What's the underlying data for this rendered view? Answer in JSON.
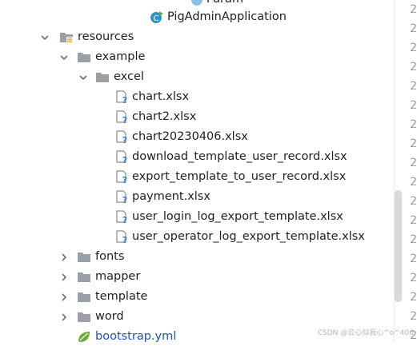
{
  "tree": {
    "partial_top_label": "Param",
    "app_class_label": "PigAdminApplication",
    "resources_label": "resources",
    "example_label": "example",
    "excel_label": "excel",
    "excel_files": [
      "chart.xlsx",
      "chart2.xlsx",
      "chart20230406.xlsx",
      "download_template_user_record.xlsx",
      "export_template_to_user_record.xlsx",
      "payment.xlsx",
      "user_login_log_export_template.xlsx",
      "user_operator_log_export_template.xlsx"
    ],
    "folders": [
      "fonts",
      "mapper",
      "template",
      "word"
    ],
    "yml_label": "bootstrap.yml"
  },
  "gutter": {
    "numbers": [
      "2",
      "2",
      "2",
      "2",
      "2",
      "2",
      "2",
      "2",
      "2",
      "2",
      "2",
      "2",
      "2",
      "2",
      "2",
      "2",
      "2",
      "2"
    ]
  },
  "watermark": "CSDN @云心似我心^o^406",
  "colors": {
    "folder": "#9aa0a6",
    "module_icon": "#3592c4",
    "yml_text": "#1a55b8",
    "unknown_file_q": "#2c7ad6"
  }
}
